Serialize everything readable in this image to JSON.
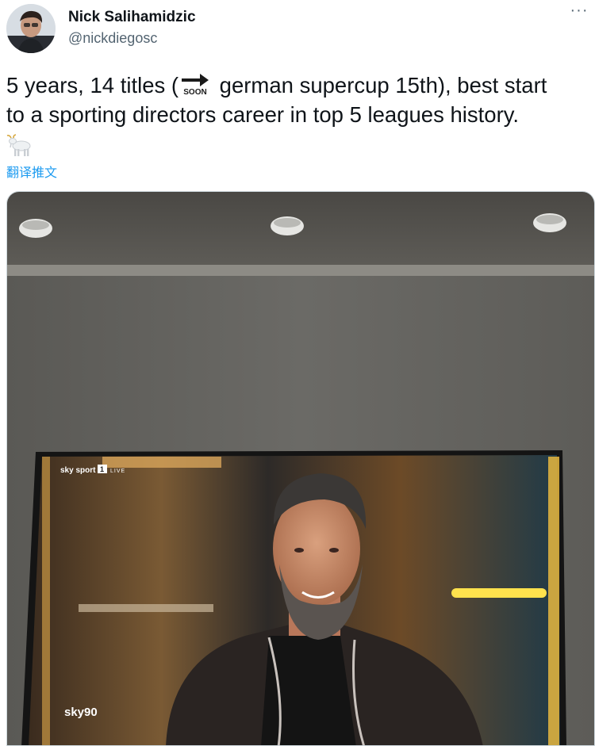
{
  "author": {
    "display_name": "Nick Salihamidzic",
    "handle": "@nickdiegosc",
    "avatar_icon": "user-avatar"
  },
  "menu": {
    "more_label": "···"
  },
  "tweet": {
    "text_part1": "5 years, 14 titles (",
    "soon_emoji_label": "SOON",
    "text_part2": " german supercup 15th), best start",
    "text_line2": "to a sporting directors career in top 5 leagues history.",
    "goat_emoji": "🐐",
    "translate_label": "翻译推文"
  },
  "media": {
    "description_icon": "photo-tv-broadcast",
    "tv_channel_label": "sky sport",
    "tv_channel_number": "1",
    "tv_live_label": "LIVE",
    "tv_corner_logo": "sky90"
  },
  "colors": {
    "link": "#1d9bf0",
    "text": "#0f1419",
    "secondary": "#536471"
  }
}
